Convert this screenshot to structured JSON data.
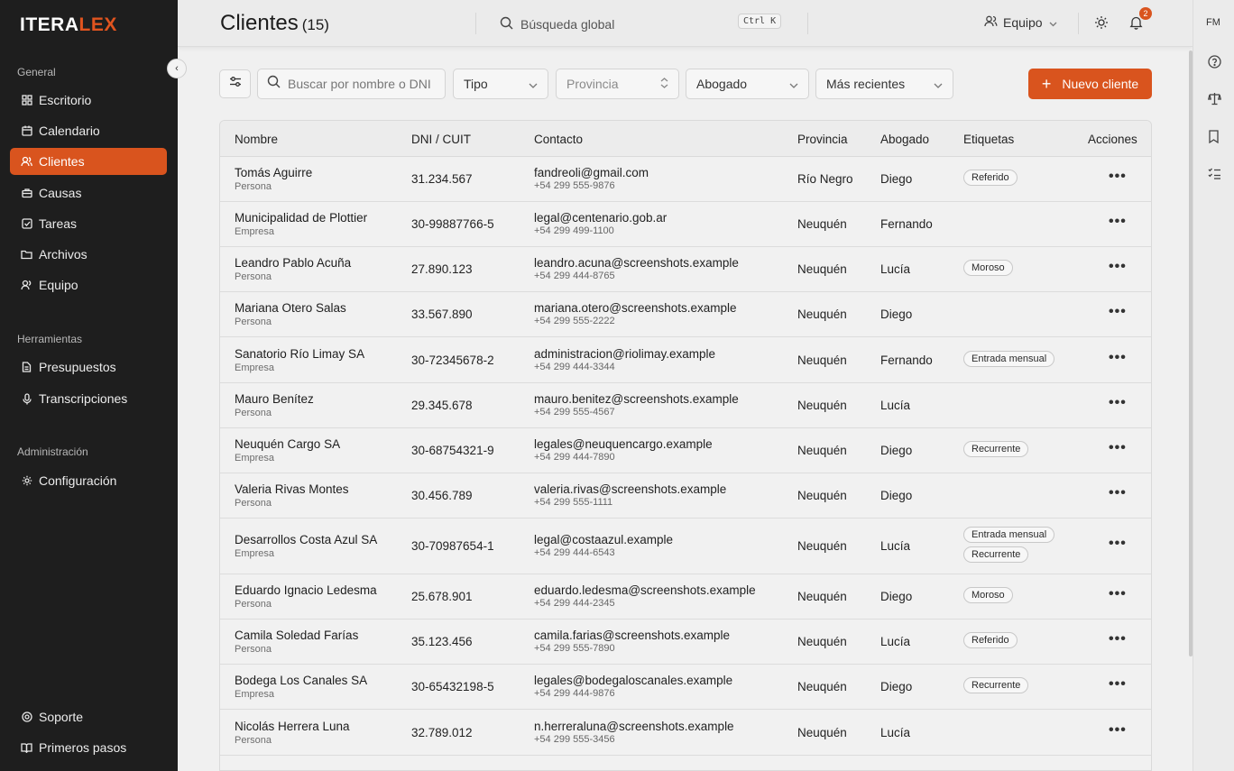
{
  "app": {
    "logo_main": "ITERA",
    "logo_accent": "LEX"
  },
  "sidebar": {
    "sections": {
      "general": "General",
      "tools": "Herramientas",
      "admin": "Administración"
    },
    "items": [
      {
        "label": "Escritorio",
        "icon": "grid-icon"
      },
      {
        "label": "Calendario",
        "icon": "calendar-icon"
      },
      {
        "label": "Clientes",
        "icon": "users-icon",
        "active": true
      },
      {
        "label": "Causas",
        "icon": "briefcase-icon"
      },
      {
        "label": "Tareas",
        "icon": "checkbox-icon"
      },
      {
        "label": "Archivos",
        "icon": "folder-icon"
      },
      {
        "label": "Equipo",
        "icon": "team-icon"
      },
      {
        "label": "Presupuestos",
        "icon": "document-icon"
      },
      {
        "label": "Transcripciones",
        "icon": "microphone-icon"
      },
      {
        "label": "Configuración",
        "icon": "gear-icon"
      }
    ],
    "footer": [
      {
        "label": "Soporte",
        "icon": "lifebuoy-icon"
      },
      {
        "label": "Primeros pasos",
        "icon": "book-icon"
      }
    ]
  },
  "header": {
    "title": "Clientes",
    "count": "(15)",
    "search_placeholder": "Búsqueda global",
    "shortcut": "Ctrl K",
    "team_label": "Equipo",
    "notifications": "2"
  },
  "rail": {
    "initials": "FM"
  },
  "toolbar": {
    "search_placeholder": "Buscar por nombre o DNI",
    "tipo": "Tipo",
    "provincia": "Provincia",
    "abogado": "Abogado",
    "orden": "Más recientes",
    "new_button": "Nuevo cliente"
  },
  "table": {
    "headers": [
      "Nombre",
      "DNI / CUIT",
      "Contacto",
      "Provincia",
      "Abogado",
      "Etiquetas",
      "Acciones"
    ],
    "rows": [
      {
        "name": "Tomás Aguirre",
        "type": "Persona",
        "id": "31.234.567",
        "email": "fandreoli@gmail.com",
        "phone": "+54 299 555-9876",
        "province": "Río Negro",
        "lawyer": "Diego",
        "tags": [
          "Referido"
        ]
      },
      {
        "name": "Municipalidad de Plottier",
        "type": "Empresa",
        "id": "30-99887766-5",
        "email": "legal@centenario.gob.ar",
        "phone": "+54 299 499-1100",
        "province": "Neuquén",
        "lawyer": "Fernando",
        "tags": []
      },
      {
        "name": "Leandro Pablo Acuña",
        "type": "Persona",
        "id": "27.890.123",
        "email": "leandro.acuna@screenshots.example",
        "phone": "+54 299 444-8765",
        "province": "Neuquén",
        "lawyer": "Lucía",
        "tags": [
          "Moroso"
        ]
      },
      {
        "name": "Mariana Otero Salas",
        "type": "Persona",
        "id": "33.567.890",
        "email": "mariana.otero@screenshots.example",
        "phone": "+54 299 555-2222",
        "province": "Neuquén",
        "lawyer": "Diego",
        "tags": []
      },
      {
        "name": "Sanatorio Río Limay SA",
        "type": "Empresa",
        "id": "30-72345678-2",
        "email": "administracion@riolimay.example",
        "phone": "+54 299 444-3344",
        "province": "Neuquén",
        "lawyer": "Fernando",
        "tags": [
          "Entrada mensual"
        ]
      },
      {
        "name": "Mauro Benítez",
        "type": "Persona",
        "id": "29.345.678",
        "email": "mauro.benitez@screenshots.example",
        "phone": "+54 299 555-4567",
        "province": "Neuquén",
        "lawyer": "Lucía",
        "tags": []
      },
      {
        "name": "Neuquén Cargo SA",
        "type": "Empresa",
        "id": "30-68754321-9",
        "email": "legales@neuquencargo.example",
        "phone": "+54 299 444-7890",
        "province": "Neuquén",
        "lawyer": "Diego",
        "tags": [
          "Recurrente"
        ]
      },
      {
        "name": "Valeria Rivas Montes",
        "type": "Persona",
        "id": "30.456.789",
        "email": "valeria.rivas@screenshots.example",
        "phone": "+54 299 555-1111",
        "province": "Neuquén",
        "lawyer": "Diego",
        "tags": []
      },
      {
        "name": "Desarrollos Costa Azul SA",
        "type": "Empresa",
        "id": "30-70987654-1",
        "email": "legal@costaazul.example",
        "phone": "+54 299 444-6543",
        "province": "Neuquén",
        "lawyer": "Lucía",
        "tags": [
          "Entrada mensual",
          "Recurrente"
        ]
      },
      {
        "name": "Eduardo Ignacio Ledesma",
        "type": "Persona",
        "id": "25.678.901",
        "email": "eduardo.ledesma@screenshots.example",
        "phone": "+54 299 444-2345",
        "province": "Neuquén",
        "lawyer": "Diego",
        "tags": [
          "Moroso"
        ]
      },
      {
        "name": "Camila Soledad Farías",
        "type": "Persona",
        "id": "35.123.456",
        "email": "camila.farias@screenshots.example",
        "phone": "+54 299 555-7890",
        "province": "Neuquén",
        "lawyer": "Lucía",
        "tags": [
          "Referido"
        ]
      },
      {
        "name": "Bodega Los Canales SA",
        "type": "Empresa",
        "id": "30-65432198-5",
        "email": "legales@bodegaloscanales.example",
        "phone": "+54 299 444-9876",
        "province": "Neuquén",
        "lawyer": "Diego",
        "tags": [
          "Recurrente"
        ]
      },
      {
        "name": "Nicolás Herrera Luna",
        "type": "Persona",
        "id": "32.789.012",
        "email": "n.herreraluna@screenshots.example",
        "phone": "+54 299 555-3456",
        "province": "Neuquén",
        "lawyer": "Lucía",
        "tags": []
      }
    ],
    "actions_glyph": "•••"
  }
}
